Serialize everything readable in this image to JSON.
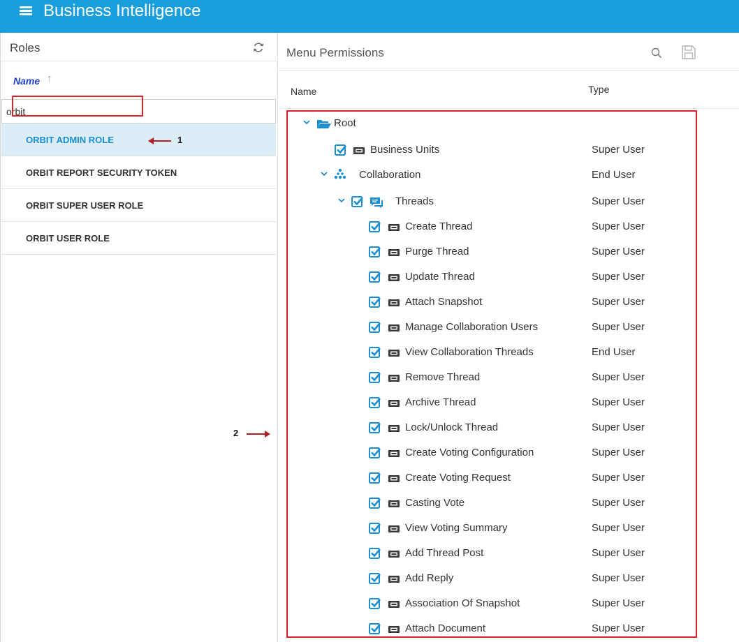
{
  "app": {
    "title": "Business Intelligence"
  },
  "left": {
    "title": "Roles",
    "sort_label": "Name",
    "sort_arrow": "↑",
    "filter_value": "orbit",
    "roles": [
      {
        "label": "ORBIT ADMIN ROLE",
        "selected": true
      },
      {
        "label": "ORBIT REPORT SECURITY TOKEN",
        "selected": false
      },
      {
        "label": "ORBIT SUPER USER ROLE",
        "selected": false
      },
      {
        "label": "ORBIT USER ROLE",
        "selected": false
      }
    ]
  },
  "annotations": {
    "one": "1",
    "two": "2"
  },
  "right": {
    "title": "Menu Permissions",
    "col_name": "Name",
    "col_type": "Type",
    "tree": [
      {
        "label": "Root",
        "type": "",
        "icon": "folder-open-icon",
        "checkbox": false,
        "chevron": true,
        "checked": false
      },
      {
        "label": "Business Units",
        "type": "Super User",
        "icon": "ticket-icon",
        "checkbox": true,
        "chevron": false,
        "checked": true
      },
      {
        "label": "Collaboration",
        "type": "End User",
        "icon": "hierarchy-icon",
        "checkbox": false,
        "chevron": true,
        "checked": false
      },
      {
        "label": "Threads",
        "type": "Super User",
        "icon": "chat-icon",
        "checkbox": true,
        "chevron": true,
        "checked": true
      },
      {
        "label": "Create Thread",
        "type": "Super User",
        "icon": "ticket-icon",
        "checkbox": true,
        "chevron": false,
        "checked": true
      },
      {
        "label": "Purge Thread",
        "type": "Super User",
        "icon": "ticket-icon",
        "checkbox": true,
        "chevron": false,
        "checked": true
      },
      {
        "label": "Update Thread",
        "type": "Super User",
        "icon": "ticket-icon",
        "checkbox": true,
        "chevron": false,
        "checked": true
      },
      {
        "label": "Attach Snapshot",
        "type": "Super User",
        "icon": "ticket-icon",
        "checkbox": true,
        "chevron": false,
        "checked": true
      },
      {
        "label": "Manage Collaboration Users",
        "type": "Super User",
        "icon": "ticket-icon",
        "checkbox": true,
        "chevron": false,
        "checked": true
      },
      {
        "label": "View Collaboration Threads",
        "type": "End User",
        "icon": "ticket-icon",
        "checkbox": true,
        "chevron": false,
        "checked": true
      },
      {
        "label": "Remove Thread",
        "type": "Super User",
        "icon": "ticket-icon",
        "checkbox": true,
        "chevron": false,
        "checked": true
      },
      {
        "label": "Archive Thread",
        "type": "Super User",
        "icon": "ticket-icon",
        "checkbox": true,
        "chevron": false,
        "checked": true
      },
      {
        "label": "Lock/Unlock Thread",
        "type": "Super User",
        "icon": "ticket-icon",
        "checkbox": true,
        "chevron": false,
        "checked": true
      },
      {
        "label": "Create Voting Configuration",
        "type": "Super User",
        "icon": "ticket-icon",
        "checkbox": true,
        "chevron": false,
        "checked": true
      },
      {
        "label": "Create Voting Request",
        "type": "Super User",
        "icon": "ticket-icon",
        "checkbox": true,
        "chevron": false,
        "checked": true
      },
      {
        "label": "Casting Vote",
        "type": "Super User",
        "icon": "ticket-icon",
        "checkbox": true,
        "chevron": false,
        "checked": true
      },
      {
        "label": "View Voting Summary",
        "type": "Super User",
        "icon": "ticket-icon",
        "checkbox": true,
        "chevron": false,
        "checked": true
      },
      {
        "label": "Add Thread Post",
        "type": "Super User",
        "icon": "ticket-icon",
        "checkbox": true,
        "chevron": false,
        "checked": true
      },
      {
        "label": "Add Reply",
        "type": "Super User",
        "icon": "ticket-icon",
        "checkbox": true,
        "chevron": false,
        "checked": true
      },
      {
        "label": "Association Of Snapshot",
        "type": "Super User",
        "icon": "ticket-icon",
        "checkbox": true,
        "chevron": false,
        "checked": true
      },
      {
        "label": "Attach Document",
        "type": "Super User",
        "icon": "ticket-icon",
        "checkbox": true,
        "chevron": false,
        "checked": true
      }
    ]
  },
  "colors": {
    "brand": "#1a9fdc",
    "annotation": "#d9232a",
    "selected_bg": "#dcedf7",
    "link": "#1f3fc9"
  }
}
